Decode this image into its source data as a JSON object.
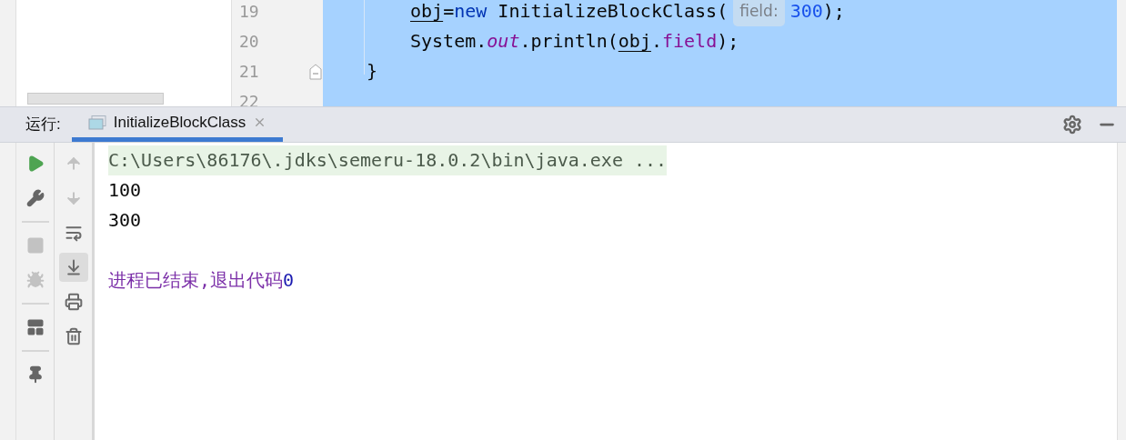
{
  "editor": {
    "lines": [
      {
        "number": "19",
        "kind": "method-body",
        "segments": [
          {
            "text": "obj",
            "kind": "reassigned"
          },
          {
            "text": "=",
            "kind": "plain"
          },
          {
            "text": "new",
            "kind": "keyword"
          },
          {
            "text": " InitializeBlockClass(",
            "kind": "plain"
          },
          {
            "text": "field:",
            "kind": "hint"
          },
          {
            "text": "300",
            "kind": "number"
          },
          {
            "text": ");",
            "kind": "plain"
          }
        ]
      },
      {
        "number": "20",
        "kind": "method-body",
        "segments": [
          {
            "text": "System.",
            "kind": "plain"
          },
          {
            "text": "out",
            "kind": "static"
          },
          {
            "text": ".println(",
            "kind": "plain"
          },
          {
            "text": "obj",
            "kind": "reassigned"
          },
          {
            "text": ".",
            "kind": "plain"
          },
          {
            "text": "field",
            "kind": "field"
          },
          {
            "text": ");",
            "kind": "plain"
          }
        ]
      },
      {
        "number": "21",
        "kind": "method",
        "fold": true,
        "segments": [
          {
            "text": "}",
            "kind": "plain"
          }
        ]
      },
      {
        "number": "22",
        "kind": "class"
      }
    ]
  },
  "run_panel": {
    "label": "运行:",
    "tabs": [
      {
        "title": "InitializeBlockClass",
        "selected": true
      }
    ],
    "left_toolbar": [
      {
        "kind": "run",
        "disabled": false
      },
      {
        "kind": "wrench",
        "disabled": false
      },
      {
        "kind": "divider"
      },
      {
        "kind": "stop",
        "disabled": true
      },
      {
        "kind": "bug",
        "disabled": true
      },
      {
        "kind": "divider"
      },
      {
        "kind": "layout",
        "disabled": false
      },
      {
        "kind": "divider"
      },
      {
        "kind": "pin",
        "disabled": false
      }
    ],
    "right_toolbar": [
      {
        "kind": "up",
        "disabled": true,
        "selected": false
      },
      {
        "kind": "down",
        "disabled": true,
        "selected": false
      },
      {
        "kind": "wrap",
        "disabled": false,
        "selected": false
      },
      {
        "kind": "scroll-end",
        "disabled": false,
        "selected": true
      },
      {
        "kind": "print",
        "disabled": false,
        "selected": false
      },
      {
        "kind": "trash",
        "disabled": false,
        "selected": false
      }
    ],
    "console": [
      {
        "kind": "command",
        "segments": [
          {
            "text": "C:\\Users\\86176\\.jdks\\semeru-18.0.2\\bin\\java.exe ...",
            "kind": "command"
          }
        ]
      },
      {
        "kind": "output",
        "segments": [
          {
            "text": "100",
            "kind": "stdout"
          }
        ]
      },
      {
        "kind": "output",
        "segments": [
          {
            "text": "300",
            "kind": "stdout"
          }
        ]
      },
      {
        "kind": "blank"
      },
      {
        "kind": "output",
        "segments": [
          {
            "text": "进程已结束,退出代码",
            "kind": "system"
          },
          {
            "text": "0",
            "kind": "exitcode"
          }
        ]
      }
    ]
  }
}
